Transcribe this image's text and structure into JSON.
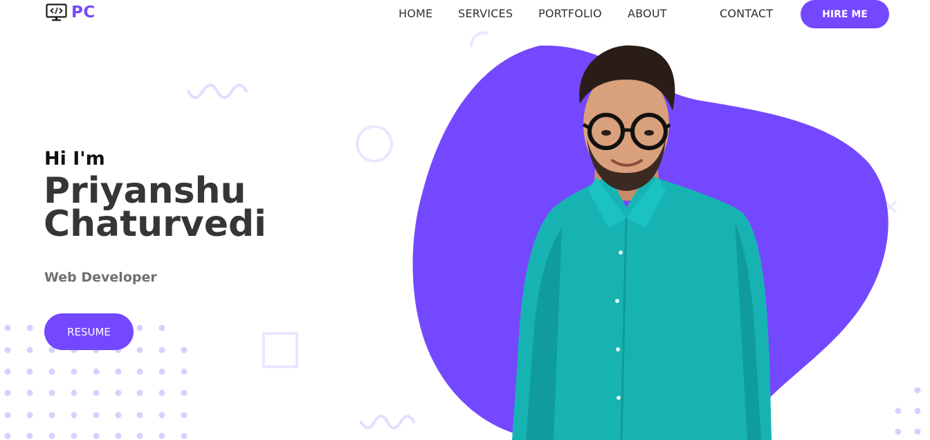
{
  "header": {
    "logo_text": "PC",
    "logo_icon": "monitor-code-icon",
    "nav": [
      "HOME",
      "SERVICES",
      "PORTFOLIO",
      "ABOUT",
      "CONTACT"
    ],
    "cta": "HIRE ME"
  },
  "hero": {
    "greeting": "Hi I'm",
    "name_first": "Priyanshu",
    "name_last": "Chaturvedi",
    "role": "Web Developer",
    "resume_button": "RESUME"
  },
  "colors": {
    "accent": "#7448ff",
    "heading": "#363636",
    "subtext": "#6f6f6f",
    "dots": "#d8d0ff",
    "shirt": "#17b3b3"
  }
}
